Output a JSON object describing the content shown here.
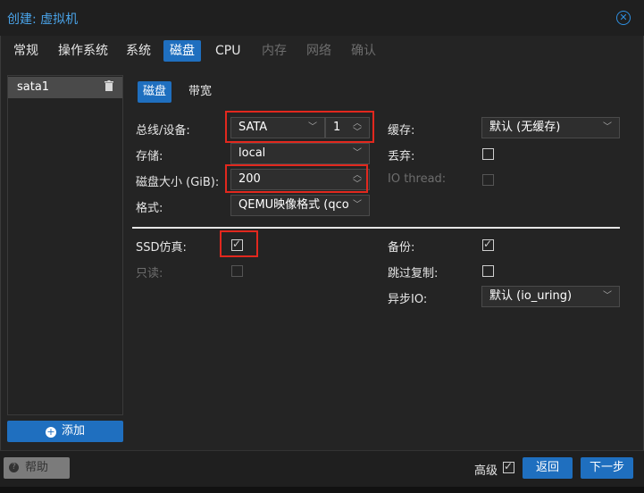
{
  "window": {
    "title": "创建: 虚拟机"
  },
  "tabs": [
    {
      "label": "常规",
      "state": "normal"
    },
    {
      "label": "操作系统",
      "state": "normal"
    },
    {
      "label": "系统",
      "state": "normal"
    },
    {
      "label": "磁盘",
      "state": "active"
    },
    {
      "label": "CPU",
      "state": "normal"
    },
    {
      "label": "内存",
      "state": "disabled"
    },
    {
      "label": "网络",
      "state": "disabled"
    },
    {
      "label": "确认",
      "state": "disabled"
    }
  ],
  "disk_list": {
    "items": [
      {
        "label": "sata1"
      }
    ],
    "add_label": "添加"
  },
  "subtabs": {
    "disk": "磁盘",
    "bandwidth": "带宽"
  },
  "form": {
    "bus_label": "总线/设备:",
    "bus_value": "SATA",
    "device_value": "1",
    "storage_label": "存储:",
    "storage_value": "local",
    "size_label": "磁盘大小 (GiB):",
    "size_value": "200",
    "format_label": "格式:",
    "format_value": "QEMU映像格式 (qco",
    "cache_label": "缓存:",
    "cache_value": "默认 (无缓存)",
    "discard_label": "丢弃:",
    "iothread_label": "IO thread:",
    "ssd_label": "SSD仿真:",
    "readonly_label": "只读:",
    "backup_label": "备份:",
    "skip_replication_label": "跳过复制:",
    "async_io_label": "异步IO:",
    "async_io_value": "默认 (io_uring)"
  },
  "footer": {
    "help": "帮助",
    "advanced": "高级",
    "back": "返回",
    "next": "下一步"
  },
  "colors": {
    "accent": "#1f6fbf",
    "highlight": "#e2281e"
  }
}
